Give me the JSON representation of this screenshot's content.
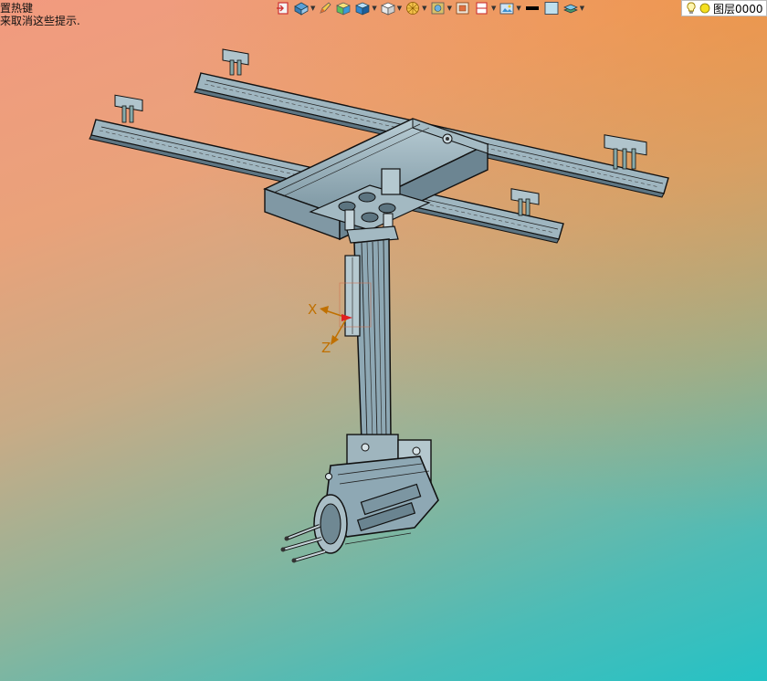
{
  "hints": {
    "line1": "置热键",
    "line2": "来取消这些提示."
  },
  "toolbar": {
    "items": [
      {
        "icon": "exit-icon",
        "dropdown": false
      },
      {
        "icon": "view-orient-icon",
        "dropdown": true
      },
      {
        "icon": "pencil-icon",
        "dropdown": false
      },
      {
        "icon": "shaded-box-icon",
        "dropdown": false
      },
      {
        "icon": "box-view-icon",
        "dropdown": true
      },
      {
        "icon": "cube-icon",
        "dropdown": true
      },
      {
        "icon": "render-sphere-icon",
        "dropdown": true
      },
      {
        "icon": "appearance-icon",
        "dropdown": true
      },
      {
        "icon": "section-view-icon",
        "dropdown": false
      },
      {
        "icon": "frame-icon",
        "dropdown": true
      },
      {
        "icon": "scene-icon",
        "dropdown": true
      },
      {
        "icon": "line-color-icon",
        "dropdown": false
      },
      {
        "icon": "face-color-icon",
        "dropdown": false
      },
      {
        "icon": "layers-icon",
        "dropdown": true
      }
    ]
  },
  "layer": {
    "label": "图层0000",
    "icons": [
      "lightbulb-icon",
      "yellow-circle-icon"
    ]
  },
  "axes": {
    "x_label": "X",
    "z_label": "Z"
  },
  "colors": {
    "model_steel": "#8ea8b4",
    "model_edge": "#1a1a1a",
    "axis_orange": "#c07000",
    "axis_red": "#e02020",
    "bg_top_left": "#f29a7f",
    "bg_top_right": "#f58c28",
    "bg_bottom": "#25c2c5"
  }
}
